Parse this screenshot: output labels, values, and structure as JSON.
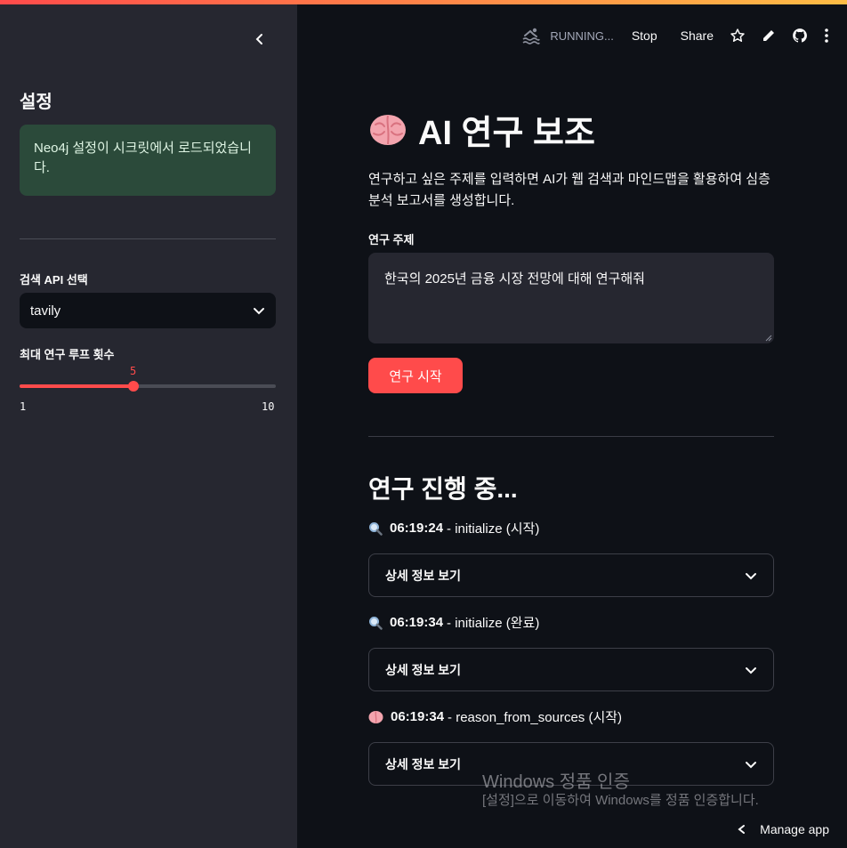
{
  "sidebar": {
    "title": "설정",
    "success_message": "Neo4j 설정이 시크릿에서 로드되었습니다.",
    "search_api": {
      "label": "검색 API 선택",
      "selected": "tavily"
    },
    "max_loops": {
      "label": "최대 연구 루프 횟수",
      "value": 5,
      "min": 1,
      "max": 10,
      "display_value": "5",
      "display_min": "1",
      "display_max": "10"
    }
  },
  "toolbar": {
    "status": "RUNNING...",
    "stop_label": "Stop",
    "share_label": "Share"
  },
  "main": {
    "title": "AI 연구 보조",
    "intro": "연구하고 싶은 주제를 입력하면 AI가 웹 검색과 마인드맵을 활용하여 심층 분석 보고서를 생성합니다.",
    "topic_label": "연구 주제",
    "topic_value": "한국의 2025년 금융 시장 전망에 대해 연구해줘",
    "start_button": "연구 시작",
    "progress_title": "연구 진행 중...",
    "logs": [
      {
        "icon": "magnifier-icon",
        "time": "06:19:24",
        "text": "- initialize (시작)",
        "expander": "상세 정보 보기"
      },
      {
        "icon": "magnifier-icon",
        "time": "06:19:34",
        "text": "- initialize (완료)",
        "expander": "상세 정보 보기"
      },
      {
        "icon": "brain-icon",
        "time": "06:19:34",
        "text": "- reason_from_sources (시작)",
        "expander": "상세 정보 보기"
      }
    ]
  },
  "watermark": {
    "line1": "Windows 정품 인증",
    "line2": "[설정]으로 이동하여 Windows를 정품 인증합니다."
  },
  "manage_app": "Manage app",
  "colors": {
    "accent": "#ff4b4b",
    "background": "#0e1117",
    "sidebar": "#262730",
    "success_bg": "#2b4a3a"
  }
}
